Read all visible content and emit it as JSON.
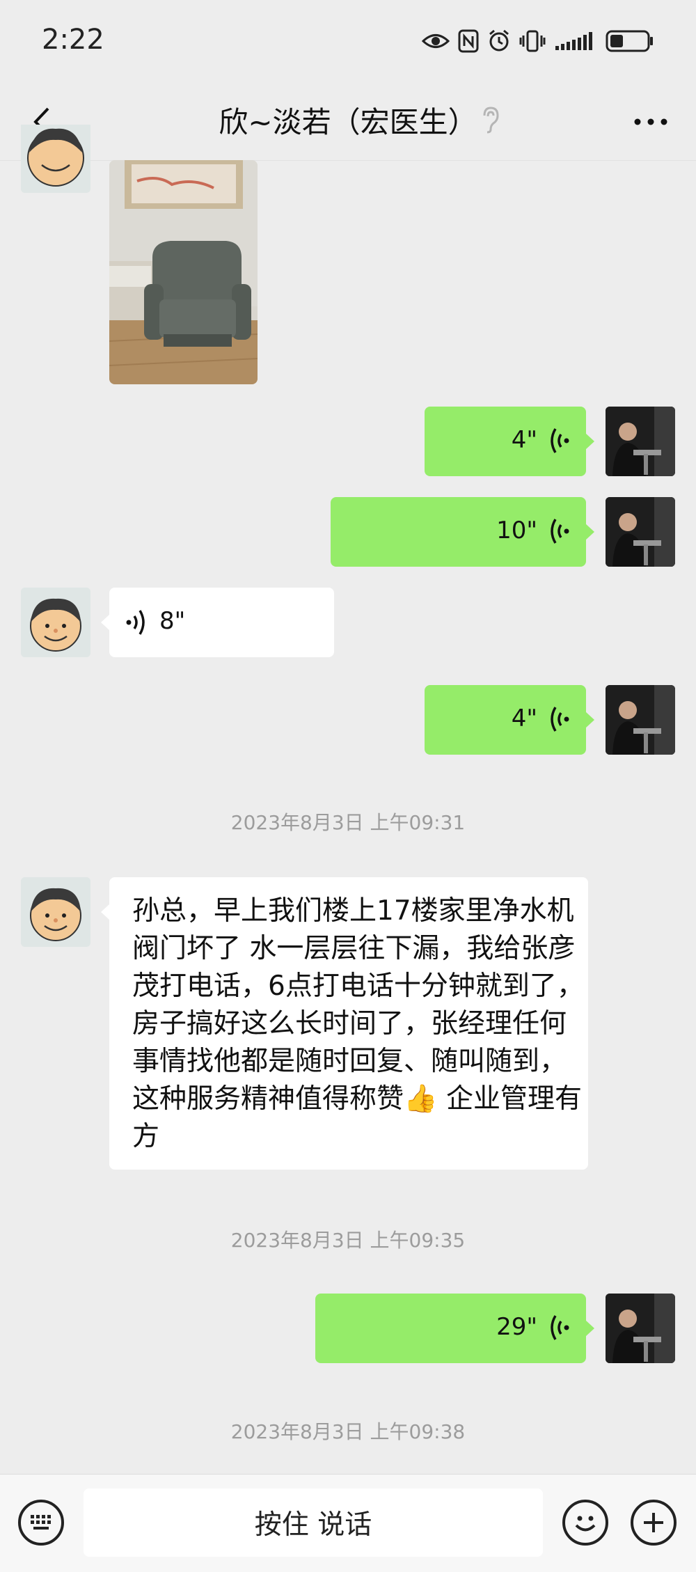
{
  "status_bar": {
    "time": "2:22",
    "battery_level": 0.35
  },
  "header": {
    "title": "欣~淡若（宏医生）",
    "back_icon": "chevron-left-icon",
    "more_icon": "more-dots-icon"
  },
  "messages": {
    "voice_out_1": {
      "duration": "4\""
    },
    "voice_out_2": {
      "duration": "10\""
    },
    "voice_in_1": {
      "duration": "8\""
    },
    "voice_out_3": {
      "duration": "4\""
    },
    "timestamp_1": "2023年8月3日 上午09:31",
    "text_in_1": "孙总，早上我们楼上17楼家里净水机阀门坏了 水一层层往下漏，我给张彦茂打电话，6点打电话十分钟就到了，房子搞好这么长时间了，张经理任何事情找他都是随时回复、随叫随到，这种服务精神值得称赞👍 企业管理有方",
    "timestamp_2": "2023年8月3日 上午09:35",
    "voice_out_4": {
      "duration": "29\""
    },
    "timestamp_3": "2023年8月3日 上午09:38"
  },
  "input_bar": {
    "hold_to_talk_label": "按住 说话"
  },
  "colors": {
    "bubble_out": "#95ec69",
    "bubble_in": "#ffffff",
    "background": "#ededed",
    "timestamp": "#9c9c9c"
  }
}
